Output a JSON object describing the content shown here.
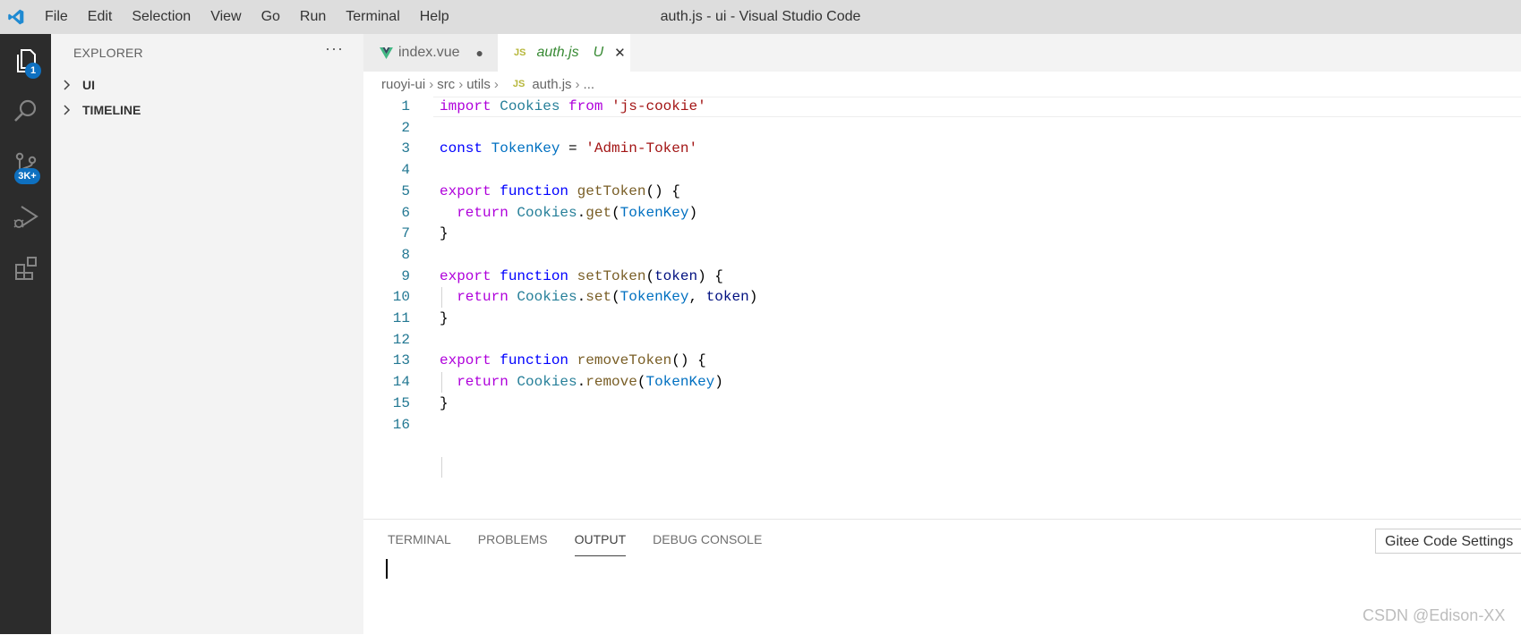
{
  "menu": [
    "File",
    "Edit",
    "Selection",
    "View",
    "Go",
    "Run",
    "Terminal",
    "Help"
  ],
  "window_title": "auth.js - ui - Visual Studio Code",
  "activity_bar": {
    "explorer_badge": "1",
    "scm_badge": "3K+",
    "icons": [
      "files-icon",
      "search-icon",
      "source-control-icon",
      "run-debug-icon",
      "extensions-icon"
    ]
  },
  "sidebar": {
    "title": "EXPLORER",
    "more": "···",
    "sections": [
      "UI",
      "TIMELINE"
    ]
  },
  "tabs": [
    {
      "icon": "vue-icon",
      "label": "index.vue",
      "state": "●"
    },
    {
      "icon": "JS",
      "label": "auth.js",
      "state": "U",
      "close": "✕"
    }
  ],
  "breadcrumb": {
    "items": [
      "ruoyi-ui",
      "src",
      "utils"
    ],
    "file_icon": "JS",
    "file": "auth.js",
    "tail": "..."
  },
  "code": {
    "lines": [
      [
        [
          "kw",
          "import"
        ],
        [
          "pu",
          " "
        ],
        [
          "ty",
          "Cookies"
        ],
        [
          "pu",
          " "
        ],
        [
          "kw",
          "from"
        ],
        [
          "pu",
          " "
        ],
        [
          "st",
          "'js-cookie'"
        ]
      ],
      [],
      [
        [
          "kd",
          "const"
        ],
        [
          "pu",
          " "
        ],
        [
          "va",
          "TokenKey"
        ],
        [
          "pu",
          " = "
        ],
        [
          "st",
          "'Admin-Token'"
        ]
      ],
      [],
      [
        [
          "kw",
          "export"
        ],
        [
          "pu",
          " "
        ],
        [
          "kd",
          "function"
        ],
        [
          "pu",
          " "
        ],
        [
          "fn",
          "getToken"
        ],
        [
          "pu",
          "() {"
        ]
      ],
      [
        [
          "pu",
          "  "
        ],
        [
          "kw",
          "return"
        ],
        [
          "pu",
          " "
        ],
        [
          "ty",
          "Cookies"
        ],
        [
          "pu",
          "."
        ],
        [
          "fn",
          "get"
        ],
        [
          "pu",
          "("
        ],
        [
          "va",
          "TokenKey"
        ],
        [
          "pu",
          ")"
        ]
      ],
      [
        [
          "pu",
          "}"
        ]
      ],
      [],
      [
        [
          "kw",
          "export"
        ],
        [
          "pu",
          " "
        ],
        [
          "kd",
          "function"
        ],
        [
          "pu",
          " "
        ],
        [
          "fn",
          "setToken"
        ],
        [
          "pu",
          "("
        ],
        [
          "pa",
          "token"
        ],
        [
          "pu",
          ") {"
        ]
      ],
      [
        [
          "pu",
          "  "
        ],
        [
          "kw",
          "return"
        ],
        [
          "pu",
          " "
        ],
        [
          "ty",
          "Cookies"
        ],
        [
          "pu",
          "."
        ],
        [
          "fn",
          "set"
        ],
        [
          "pu",
          "("
        ],
        [
          "va",
          "TokenKey"
        ],
        [
          "pu",
          ", "
        ],
        [
          "pa",
          "token"
        ],
        [
          "pu",
          ")"
        ]
      ],
      [
        [
          "pu",
          "}"
        ]
      ],
      [],
      [
        [
          "kw",
          "export"
        ],
        [
          "pu",
          " "
        ],
        [
          "kd",
          "function"
        ],
        [
          "pu",
          " "
        ],
        [
          "fn",
          "removeToken"
        ],
        [
          "pu",
          "() {"
        ]
      ],
      [
        [
          "pu",
          "  "
        ],
        [
          "kw",
          "return"
        ],
        [
          "pu",
          " "
        ],
        [
          "ty",
          "Cookies"
        ],
        [
          "pu",
          "."
        ],
        [
          "fn",
          "remove"
        ],
        [
          "pu",
          "("
        ],
        [
          "va",
          "TokenKey"
        ],
        [
          "pu",
          ")"
        ]
      ],
      [
        [
          "pu",
          "}"
        ]
      ],
      []
    ]
  },
  "panel": {
    "tabs": [
      "TERMINAL",
      "PROBLEMS",
      "OUTPUT",
      "DEBUG CONSOLE"
    ],
    "active_tab": "OUTPUT",
    "channel": "Gitee Code Settings"
  },
  "watermark": "CSDN @Edison-XX",
  "colors": {
    "accent": "#0e70c0",
    "activity_bar": "#2c2c2c",
    "title_bar": "#dddddd",
    "vue_green": "#41b883",
    "untracked_green": "#388a34"
  }
}
